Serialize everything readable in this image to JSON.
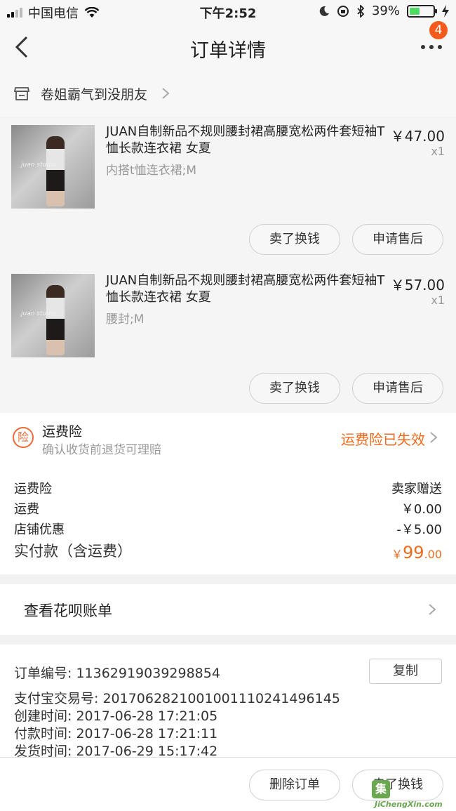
{
  "status": {
    "carrier": "中国电信",
    "time": "下午2:52",
    "battery": "39%"
  },
  "nav": {
    "title": "订单详情",
    "badge": "4",
    "back_icon": "chevron-left-icon",
    "more_icon": "more-dots-icon"
  },
  "shop": {
    "name": "卷姐霸气到没朋友",
    "icon": "store-icon"
  },
  "items": [
    {
      "title": "JUAN自制新品不规则腰封裙高腰宽松两件套短袖T恤长款连衣裙 女夏",
      "spec": "内搭t恤连衣裙;M",
      "price": "￥47.00",
      "qty": "x1",
      "watermark": "juan studio",
      "btn_sell": "卖了换钱",
      "btn_after": "申请售后"
    },
    {
      "title": "JUAN自制新品不规则腰封裙高腰宽松两件套短袖T恤长款连衣裙 女夏",
      "spec": "腰封;M",
      "price": "￥57.00",
      "qty": "x1",
      "watermark": "juan studio",
      "btn_sell": "卖了换钱",
      "btn_after": "申请售后"
    }
  ],
  "insurance": {
    "icon_text": "险",
    "title": "运费险",
    "subtitle": "确认收货前退货可理赔",
    "status": "运费险已失效"
  },
  "fees": {
    "insurance_label": "运费险",
    "insurance_value": "卖家赠送",
    "shipping_label": "运费",
    "shipping_value": "￥0.00",
    "discount_label": "店铺优惠",
    "discount_value": "-￥5.00",
    "total_label": "实付款（含运费）",
    "total_currency": "￥",
    "total_int": "99",
    "total_dec": ".00"
  },
  "huabei": {
    "label": "查看花呗账单"
  },
  "order": {
    "number": "订单编号:  11362919039298854",
    "copy": "复制",
    "alipay": "支付宝交易号:  2017062821001001110241496145",
    "created": "创建时间:  2017-06-28 17:21:05",
    "paid": "付款时间:  2017-06-28 17:21:11",
    "shipped": "发货时间:  2017-06-29 15:17:42"
  },
  "bottom": {
    "delete": "删除订单",
    "sell": "卖了换钱"
  },
  "watermark": {
    "char": "集",
    "text": "JiChengXin.com"
  },
  "colors": {
    "accent": "#f06a1d",
    "badge": "#f55a1d",
    "battery": "#4cd964"
  }
}
